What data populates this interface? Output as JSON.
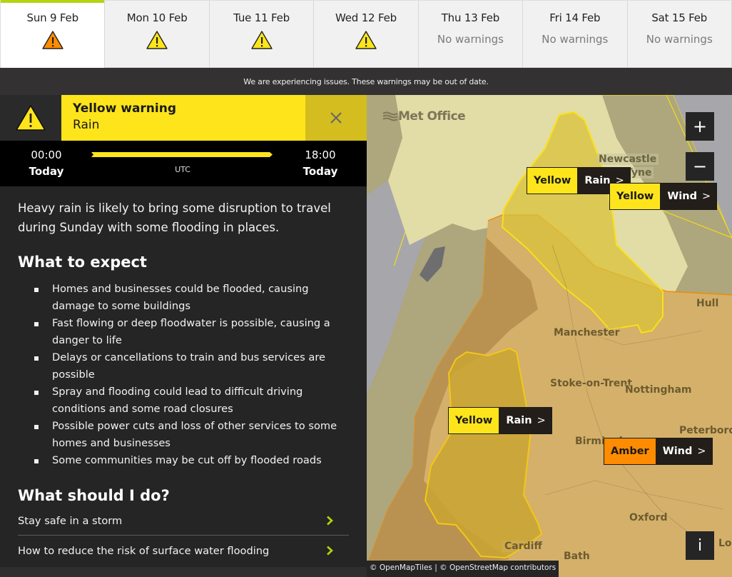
{
  "tabs": [
    {
      "label": "Sun 9 Feb",
      "status": "amber-warning-icon",
      "active": true
    },
    {
      "label": "Mon 10 Feb",
      "status": "yellow-warning-icon"
    },
    {
      "label": "Tue 11 Feb",
      "status": "yellow-warning-icon"
    },
    {
      "label": "Wed 12 Feb",
      "status": "yellow-warning-icon"
    },
    {
      "label": "Thu 13 Feb",
      "none_text": "No warnings"
    },
    {
      "label": "Fri 14 Feb",
      "none_text": "No warnings"
    },
    {
      "label": "Sat 15 Feb",
      "none_text": "No warnings"
    }
  ],
  "banner": "We are experiencing issues. These warnings may be out of date.",
  "warning": {
    "title": "Yellow warning",
    "type": "Rain",
    "close_icon": "close-icon",
    "start_time": "00:00",
    "start_day": "Today",
    "end_time": "18:00",
    "end_day": "Today",
    "timezone": "UTC",
    "summary": "Heavy rain is likely to bring some disruption to travel during Sunday with some flooding in places.",
    "expect_heading": "What to expect",
    "expect_items": [
      "Homes and businesses could be flooded, causing damage to some buildings",
      "Fast flowing or deep floodwater is possible, causing a danger to life",
      "Delays or cancellations to train and bus services are possible",
      "Spray and flooding could lead to difficult driving conditions and some road closures",
      "Possible power cuts and loss of other services to some homes and businesses",
      "Some communities may be cut off by flooded roads"
    ],
    "todo_heading": "What should I do?",
    "links": [
      "Stay safe in a storm",
      "How to reduce the risk of surface water flooding"
    ]
  },
  "map": {
    "logo": "Met Office",
    "zoom_in": "+",
    "zoom_out": "−",
    "info": "i",
    "attribution": "© OpenMapTiles | © OpenStreetMap contributors",
    "cities": [
      "Newcastle",
      "Tyne",
      "Hull",
      "Manchester",
      "Stoke-on-Trent",
      "Nottingham",
      "Birmingham",
      "Peterborough",
      "Oxford",
      "Cardiff",
      "Bath",
      "London"
    ],
    "chips": [
      {
        "level": "Yellow",
        "type": "Rain",
        "arrow": ">"
      },
      {
        "level": "Yellow",
        "type": "Wind",
        "arrow": ">"
      },
      {
        "level": "Yellow",
        "type": "Rain",
        "arrow": ">"
      },
      {
        "level": "Amber",
        "type": "Wind",
        "arrow": ">"
      }
    ]
  },
  "colors": {
    "yellow": "#fee51b",
    "amber": "#ff8c00",
    "active_tab_accent": "#b6d40f",
    "link_chevron": "#b6d40f"
  }
}
